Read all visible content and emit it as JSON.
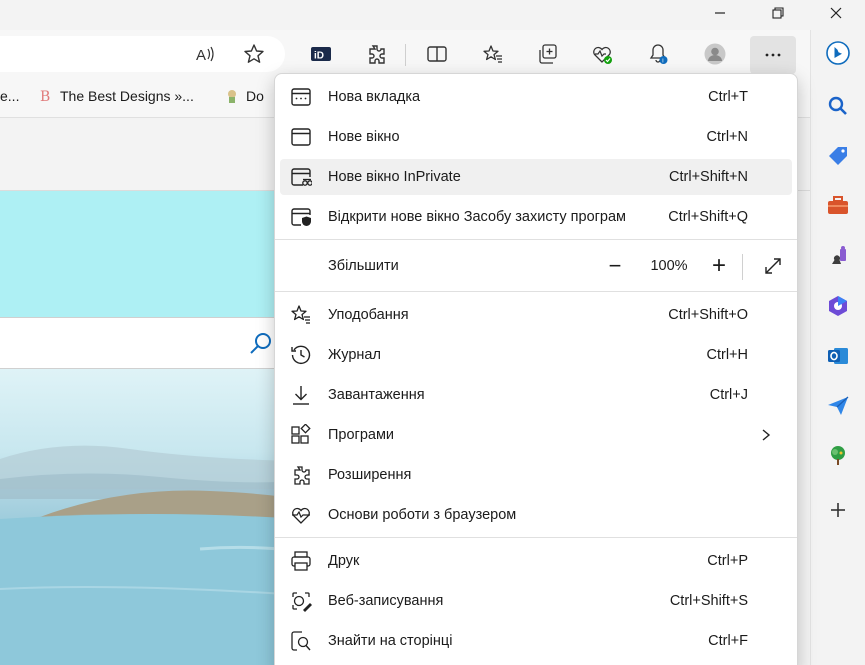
{
  "window_controls": {
    "minimize": "minimize-icon",
    "maximize": "restore-icon",
    "close": "close-icon"
  },
  "toolbar": {
    "icons": [
      "read-aloud-icon",
      "favorite-star-icon",
      "id-extension-icon",
      "extensions-icon",
      "split-screen-icon",
      "favorites-icon",
      "collections-icon",
      "browser-essentials-icon",
      "notifications-icon",
      "profile-avatar",
      "more-icon",
      "bing-icon"
    ]
  },
  "favorites_bar": {
    "items": [
      {
        "label": "e..."
      },
      {
        "label": "The Best Designs »..."
      },
      {
        "label": "Do"
      }
    ]
  },
  "menu": {
    "items": [
      {
        "label": "Нова вкладка",
        "shortcut": "Ctrl+T",
        "icon": "new-tab-icon"
      },
      {
        "label": "Нове вікно",
        "shortcut": "Ctrl+N",
        "icon": "new-window-icon"
      },
      {
        "label": "Нове вікно InPrivate",
        "shortcut": "Ctrl+Shift+N",
        "icon": "inprivate-icon"
      },
      {
        "label": "Відкрити нове вікно Засобу захисту програм",
        "shortcut": "Ctrl+Shift+Q",
        "icon": "app-guard-icon"
      }
    ],
    "zoom": {
      "label": "Збільшити",
      "value": "100%",
      "minus": "−",
      "plus": "+"
    },
    "items2": [
      {
        "label": "Уподобання",
        "shortcut": "Ctrl+Shift+O",
        "icon": "favorites-icon"
      },
      {
        "label": "Журнал",
        "shortcut": "Ctrl+H",
        "icon": "history-icon"
      },
      {
        "label": "Завантаження",
        "shortcut": "Ctrl+J",
        "icon": "download-icon"
      },
      {
        "label": "Програми",
        "shortcut": "",
        "icon": "apps-icon"
      },
      {
        "label": "Розширення",
        "shortcut": "",
        "icon": "extensions-icon"
      },
      {
        "label": "Основи роботи з браузером",
        "shortcut": "",
        "icon": "browser-essentials-icon"
      }
    ],
    "items3": [
      {
        "label": "Друк",
        "shortcut": "Ctrl+P",
        "icon": "print-icon"
      },
      {
        "label": "Веб-записування",
        "shortcut": "Ctrl+Shift+S",
        "icon": "web-capture-icon"
      },
      {
        "label": "Знайти на сторінці",
        "shortcut": "Ctrl+F",
        "icon": "find-icon"
      }
    ]
  },
  "sidebar": {
    "icons": [
      "search-icon",
      "shopping-tag-icon",
      "tools-briefcase-icon",
      "games-icon",
      "microsoft365-icon",
      "outlook-icon",
      "drop-send-icon",
      "tree-icon",
      "add-icon"
    ]
  },
  "colors": {
    "accent": "#0f6cbd",
    "cyan_band": "#aef0f4"
  }
}
